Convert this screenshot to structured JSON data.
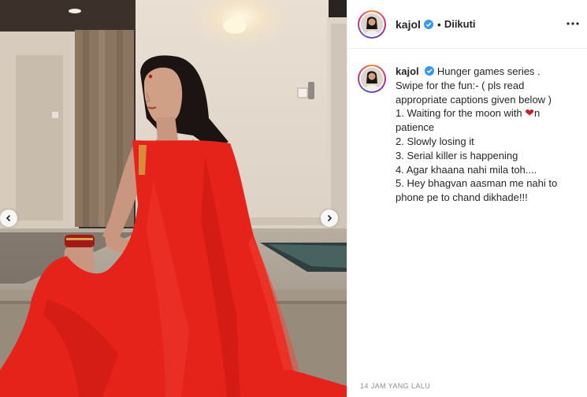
{
  "post": {
    "username": "kajol",
    "follow_separator": "•",
    "follow_label": "Diikuti",
    "caption_lead": "Hunger games series . Swipe for the fun:- ( pls read appropriate captions given below )",
    "caption_lines": [
      "1. Waiting for the moon with ",
      "n patience",
      "2. Slowly losing it",
      "3. Serial killer is happening",
      "4. Agar khaana nahi mila toh....",
      "5. Hey bhagvan aasman me nahi to phone pe to chand dikhade!!!"
    ],
    "heart_glyph": "❤",
    "timestamp": "14 JAM YANG LALU"
  },
  "icons": {
    "verified": "verified-badge-icon",
    "more": "more-options-icon",
    "prev": "chevron-left-icon",
    "next": "chevron-right-icon"
  },
  "colors": {
    "saree": "#e5231b",
    "verified": "#3897f0",
    "heart": "#c41e2a"
  }
}
